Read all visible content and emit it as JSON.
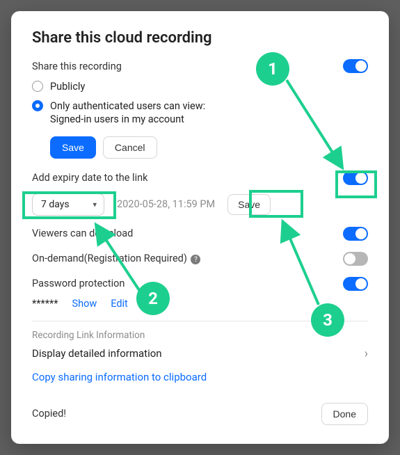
{
  "title": "Share this cloud recording",
  "share_section": {
    "label": "Share this recording",
    "options": {
      "publicly": "Publicly",
      "auth_line1": "Only authenticated users can view:",
      "auth_line2": "Signed-in users in my account"
    }
  },
  "buttons": {
    "save": "Save",
    "cancel": "Cancel",
    "save_expiry": "Save",
    "done": "Done"
  },
  "expiry": {
    "label": "Add expiry date to the link",
    "select_value": "7 days",
    "datetime": "2020-05-28, 11:59 PM"
  },
  "viewers_download": {
    "label": "Viewers can download"
  },
  "on_demand": {
    "label": "On-demand(Registration Required)"
  },
  "password": {
    "label": "Password protection",
    "masked": "******",
    "show": "Show",
    "edit": "Edit"
  },
  "recording_info": {
    "heading": "Recording Link Information",
    "display_detail": "Display detailed information",
    "copy": "Copy sharing information to clipboard"
  },
  "status": {
    "copied": "Copied!"
  },
  "annotations": {
    "one": "1",
    "two": "2",
    "three": "3"
  }
}
